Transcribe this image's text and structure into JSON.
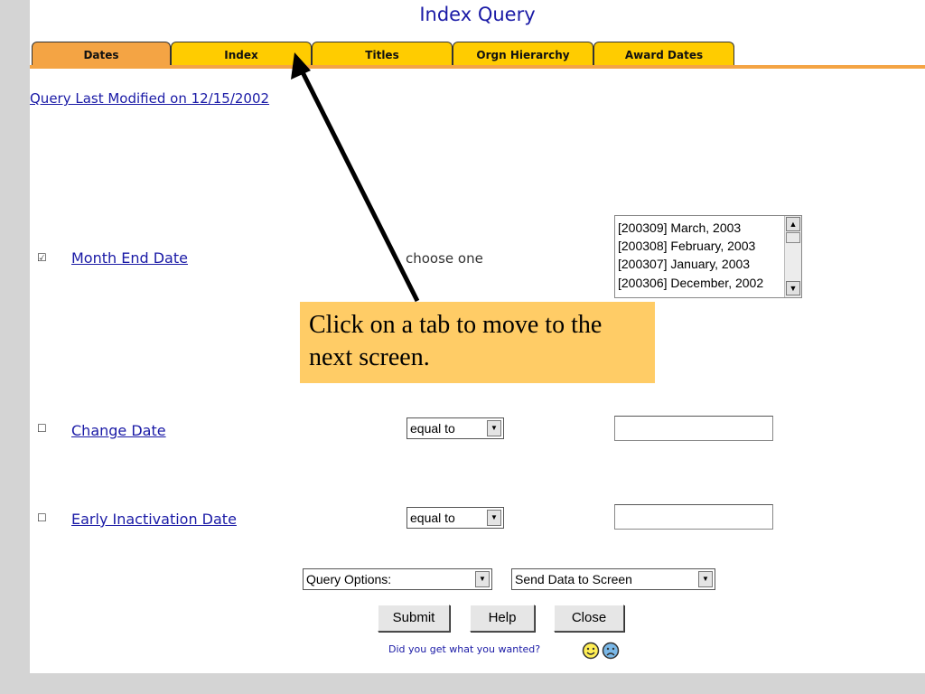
{
  "window": {
    "title": "Index Query"
  },
  "tabs": [
    {
      "label": "Dates",
      "active": true
    },
    {
      "label": "Index",
      "active": false
    },
    {
      "label": "Titles",
      "active": false
    },
    {
      "label": "Orgn Hierarchy",
      "active": false
    },
    {
      "label": "Award Dates",
      "active": false
    }
  ],
  "last_modified": "Query Last Modified on 12/15/2002",
  "fields": {
    "month_end": {
      "label": "Month End Date",
      "checked": true,
      "choose_text": "choose one",
      "options": [
        "[200309] March, 2003",
        "[200308] February, 2003",
        "[200307] January, 2003",
        "[200306] December, 2002"
      ]
    },
    "change_date": {
      "label": "Change Date",
      "checked": false,
      "operator": "equal to",
      "value": ""
    },
    "early_inactivation": {
      "label": "Early Inactivation Date",
      "checked": false,
      "operator": "equal to",
      "value": ""
    }
  },
  "footer": {
    "query_options": "Query Options:",
    "send_data": "Send Data to Screen",
    "submit": "Submit",
    "help": "Help",
    "close": "Close",
    "feedback": "Did you get what you wanted?"
  },
  "callout": {
    "text": "Click on a tab to move to the next screen."
  },
  "colors": {
    "active_tab": "#f4a444",
    "inactive_tab": "#ffcc00",
    "link": "#1a1aa6",
    "callout": "#ffcc66"
  },
  "icons": {
    "happy": "smiley-icon",
    "sad": "frown-icon"
  }
}
